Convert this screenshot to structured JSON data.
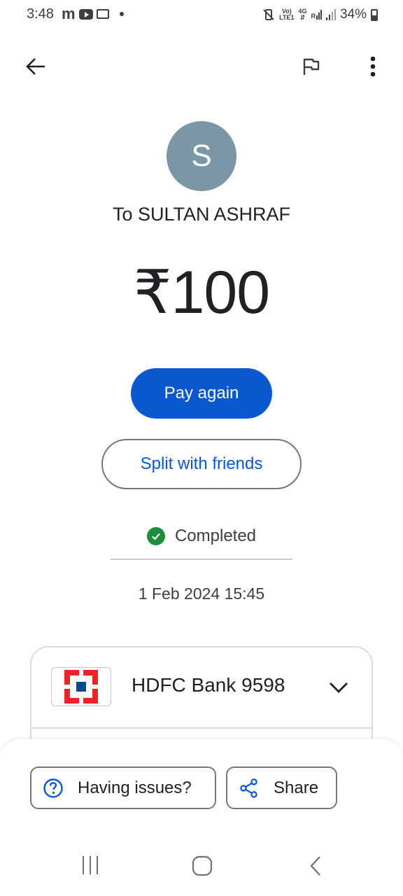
{
  "status_bar": {
    "time": "3:48",
    "network_vo": "Vo)",
    "network_lte": "LTE1",
    "network_4g": "4G",
    "network_r": "R",
    "battery": "34%"
  },
  "app_bar": {
    "back_icon": "arrow-left-icon",
    "flag_icon": "flag-icon",
    "more_icon": "more-vert-icon"
  },
  "recipient": {
    "avatar_letter": "S",
    "avatar_color": "#7b97a6",
    "label": "To SULTAN ASHRAF"
  },
  "amount": "₹100",
  "actions": {
    "pay_again": "Pay again",
    "split": "Split with friends"
  },
  "transaction": {
    "status": "Completed",
    "status_color": "#1e8e3e",
    "datetime": "1 Feb 2024 15:45"
  },
  "bank": {
    "name": "HDFC Bank 9598",
    "logo_icon": "hdfc-logo-icon"
  },
  "bottom_actions": {
    "issues": "Having issues?",
    "share": "Share"
  },
  "colors": {
    "primary": "#0b57d0",
    "outline": "#74777f"
  }
}
